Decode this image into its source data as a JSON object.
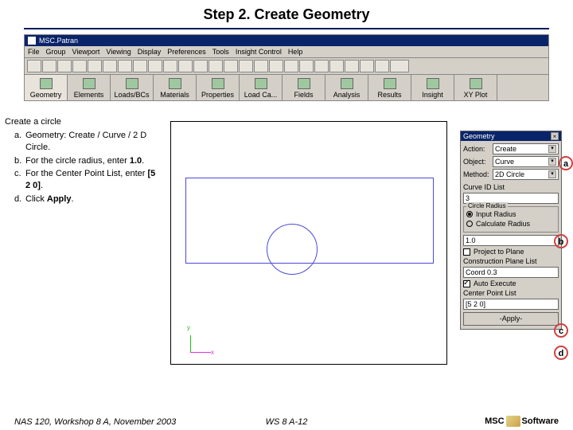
{
  "title": "Step 2. Create Geometry",
  "app": {
    "window_title": "MSC.Patran",
    "menus": [
      "File",
      "Group",
      "Viewport",
      "Viewing",
      "Display",
      "Preferences",
      "Tools",
      "Insight Control",
      "Help"
    ],
    "tabs": [
      "Geometry",
      "Elements",
      "Loads/BCs",
      "Materials",
      "Properties",
      "Load Ca...",
      "Fields",
      "Analysis",
      "Results",
      "Insight",
      "XY Plot"
    ]
  },
  "instructions": {
    "lead": "Create a circle",
    "items": [
      {
        "letter": "a.",
        "text": "Geometry: Create / Curve / 2 D Circle."
      },
      {
        "letter": "b.",
        "html": "For the circle radius, enter <b>1.0</b>."
      },
      {
        "letter": "c.",
        "html": "For the Center Point List, enter <b>[5 2 0]</b>."
      },
      {
        "letter": "d.",
        "html": "Click <b>Apply</b>."
      }
    ]
  },
  "panel": {
    "title": "Geometry",
    "action_label": "Action:",
    "action_value": "Create",
    "object_label": "Object:",
    "object_value": "Curve",
    "method_label": "Method:",
    "method_value": "2D Circle",
    "curveid_label": "Curve ID List",
    "curveid_value": "3",
    "radius_group": "Circle Radius",
    "radius_opt1": "Input Radius",
    "radius_opt2": "Calculate Radius",
    "radius_value": "1.0",
    "project_label": "Project to Plane",
    "plane_label": "Construction Plane List",
    "plane_value": "Coord 0.3",
    "autoexec_label": "Auto Execute",
    "center_label": "Center Point List",
    "center_value": "[5 2 0]",
    "apply_label": "-Apply-"
  },
  "axes": {
    "x": "x",
    "y": "y"
  },
  "callouts": {
    "a": "a",
    "b": "b",
    "c": "c",
    "d": "d"
  },
  "footer": {
    "left": "NAS 120, Workshop 8 A, November 2003",
    "mid": "WS 8 A-12",
    "logo_pre": "MSC",
    "logo_post": "Software"
  }
}
